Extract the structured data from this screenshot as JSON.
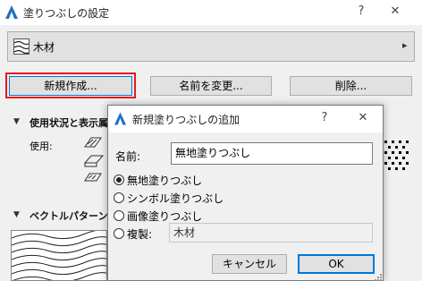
{
  "window": {
    "title": "塗りつぶしの設定",
    "help_label": "?",
    "close_label": "✕"
  },
  "fill_selector": {
    "name": "木材",
    "arrow": "▸"
  },
  "buttons": {
    "new": "新規作成...",
    "rename": "名前を変更...",
    "delete": "削除..."
  },
  "sections": {
    "usage_header": "使用状況と表示属",
    "usage_label": "使用:",
    "vector_header": "ベクトルパターンを"
  },
  "dialog": {
    "title": "新規塗りつぶしの追加",
    "help_label": "?",
    "close_label": "✕",
    "name_label": "名前:",
    "name_value": "無地塗りつぶし",
    "options": [
      {
        "label": "無地塗りつぶし",
        "checked": true
      },
      {
        "label": "シンボル塗りつぶし",
        "checked": false
      },
      {
        "label": "画像塗りつぶし",
        "checked": false
      },
      {
        "label": "複製:",
        "checked": false
      }
    ],
    "duplicate_value": "木材",
    "cancel_label": "キャンセル",
    "ok_label": "OK"
  },
  "colors": {
    "focus_outline": "#e8191c",
    "ok_border": "#0078d7",
    "app_icon": "#1f6fc5"
  }
}
